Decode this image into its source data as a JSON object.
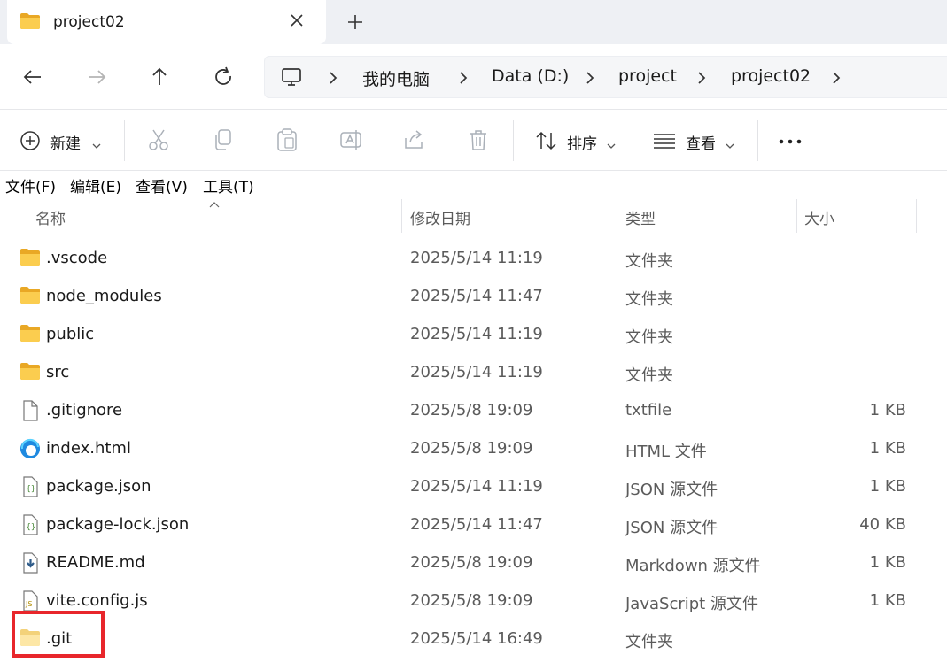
{
  "tab": {
    "title": "project02"
  },
  "breadcrumb": [
    "我的电脑",
    "Data (D:)",
    "project",
    "project02"
  ],
  "commands": {
    "new_label": "新建",
    "sort_label": "排序",
    "view_label": "查看"
  },
  "menu": [
    "文件(F)",
    "编辑(E)",
    "查看(V)",
    "工具(T)"
  ],
  "columns": {
    "name": "名称",
    "modified": "修改日期",
    "type": "类型",
    "size": "大小"
  },
  "files": [
    {
      "name": ".vscode",
      "modified": "2025/5/14 11:19",
      "type": "文件夹",
      "size": "",
      "icon": "folder-icon"
    },
    {
      "name": "node_modules",
      "modified": "2025/5/14 11:47",
      "type": "文件夹",
      "size": "",
      "icon": "folder-icon"
    },
    {
      "name": "public",
      "modified": "2025/5/14 11:19",
      "type": "文件夹",
      "size": "",
      "icon": "folder-icon"
    },
    {
      "name": "src",
      "modified": "2025/5/14 11:19",
      "type": "文件夹",
      "size": "",
      "icon": "folder-icon"
    },
    {
      "name": ".gitignore",
      "modified": "2025/5/8 19:09",
      "type": "txtfile",
      "size": "1 KB",
      "icon": "text-file-icon"
    },
    {
      "name": "index.html",
      "modified": "2025/5/8 19:09",
      "type": "HTML 文件",
      "size": "1 KB",
      "icon": "edge-html-icon"
    },
    {
      "name": "package.json",
      "modified": "2025/5/14 11:19",
      "type": "JSON 源文件",
      "size": "1 KB",
      "icon": "json-file-icon"
    },
    {
      "name": "package-lock.json",
      "modified": "2025/5/14 11:47",
      "type": "JSON 源文件",
      "size": "40 KB",
      "icon": "json-file-icon"
    },
    {
      "name": "README.md",
      "modified": "2025/5/8 19:09",
      "type": "Markdown 源文件",
      "size": "1 KB",
      "icon": "markdown-file-icon"
    },
    {
      "name": "vite.config.js",
      "modified": "2025/5/8 19:09",
      "type": "JavaScript 源文件",
      "size": "1 KB",
      "icon": "js-file-icon"
    },
    {
      "name": ".git",
      "modified": "2025/5/14 16:49",
      "type": "文件夹",
      "size": "",
      "icon": "hidden-folder-icon"
    }
  ],
  "colors": {
    "highlight": "#e8262b",
    "folder": "#f8c94a",
    "accent": "#0067c0"
  }
}
